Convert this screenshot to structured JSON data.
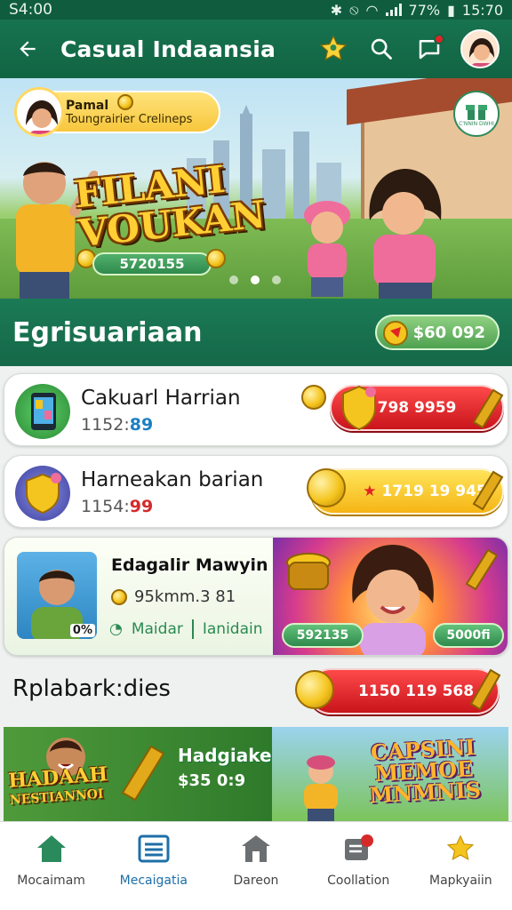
{
  "status": {
    "left": "S4:00",
    "battery": "77%",
    "time": "15:70"
  },
  "app_bar": {
    "title": "Casual Indaansia"
  },
  "hero": {
    "user_name": "Pamal",
    "user_subtitle": "Toungrairier Crelineps",
    "badge_text": "C'NNIN  DWHI",
    "title_line1": "FILANI",
    "title_line2": "VOUKAN",
    "pill_value": "5720155",
    "carousel": {
      "count": 3,
      "active": 1
    }
  },
  "section1": {
    "title": "Egrisuariaan",
    "balance": "$60 092"
  },
  "rows": [
    {
      "title": "Cakuarl Harrian",
      "sub_main": "1152:",
      "sub_accent": "89",
      "accent_color": "#1d7fc4",
      "action_value": "798 9959",
      "action_style": "red"
    },
    {
      "title": "Harneakan barian",
      "sub_main": "1154:",
      "sub_accent": "99",
      "accent_color": "#d62a2a",
      "action_value": "1719 19 945",
      "action_style": "yellow"
    }
  ],
  "feature": {
    "title": "Edagalir Mawyin",
    "subtitle": "95kmm.3 81",
    "photo_tag": "0%",
    "meta_left": "Maidar",
    "meta_right": "Ianidain",
    "pill_left": "592135",
    "pill_right": "5000fi"
  },
  "section2": {
    "title": "Rplabark:dies",
    "action_value": "1150 119 568"
  },
  "promo": {
    "game_title_1": "HADAAH",
    "game_title_2": "NESTIANNOI",
    "name": "Hadgiake",
    "price": "$35 0:9",
    "right_title_1": "CAPSINI",
    "right_title_2": "MEMOE",
    "right_title_3": "MNMNIS"
  },
  "nav": [
    {
      "label": "Mocaimam",
      "icon": "home-icon"
    },
    {
      "label": "Mecaigatia",
      "icon": "list-icon"
    },
    {
      "label": "Dareon",
      "icon": "store-icon"
    },
    {
      "label": "Coollation",
      "icon": "collection-icon"
    },
    {
      "label": "Mapkyaiin",
      "icon": "star-icon"
    }
  ],
  "colors": {
    "primary": "#17734f",
    "accent_red": "#d62a2a",
    "accent_yellow": "#f5b515",
    "nav_active": "#1d6fa8"
  }
}
